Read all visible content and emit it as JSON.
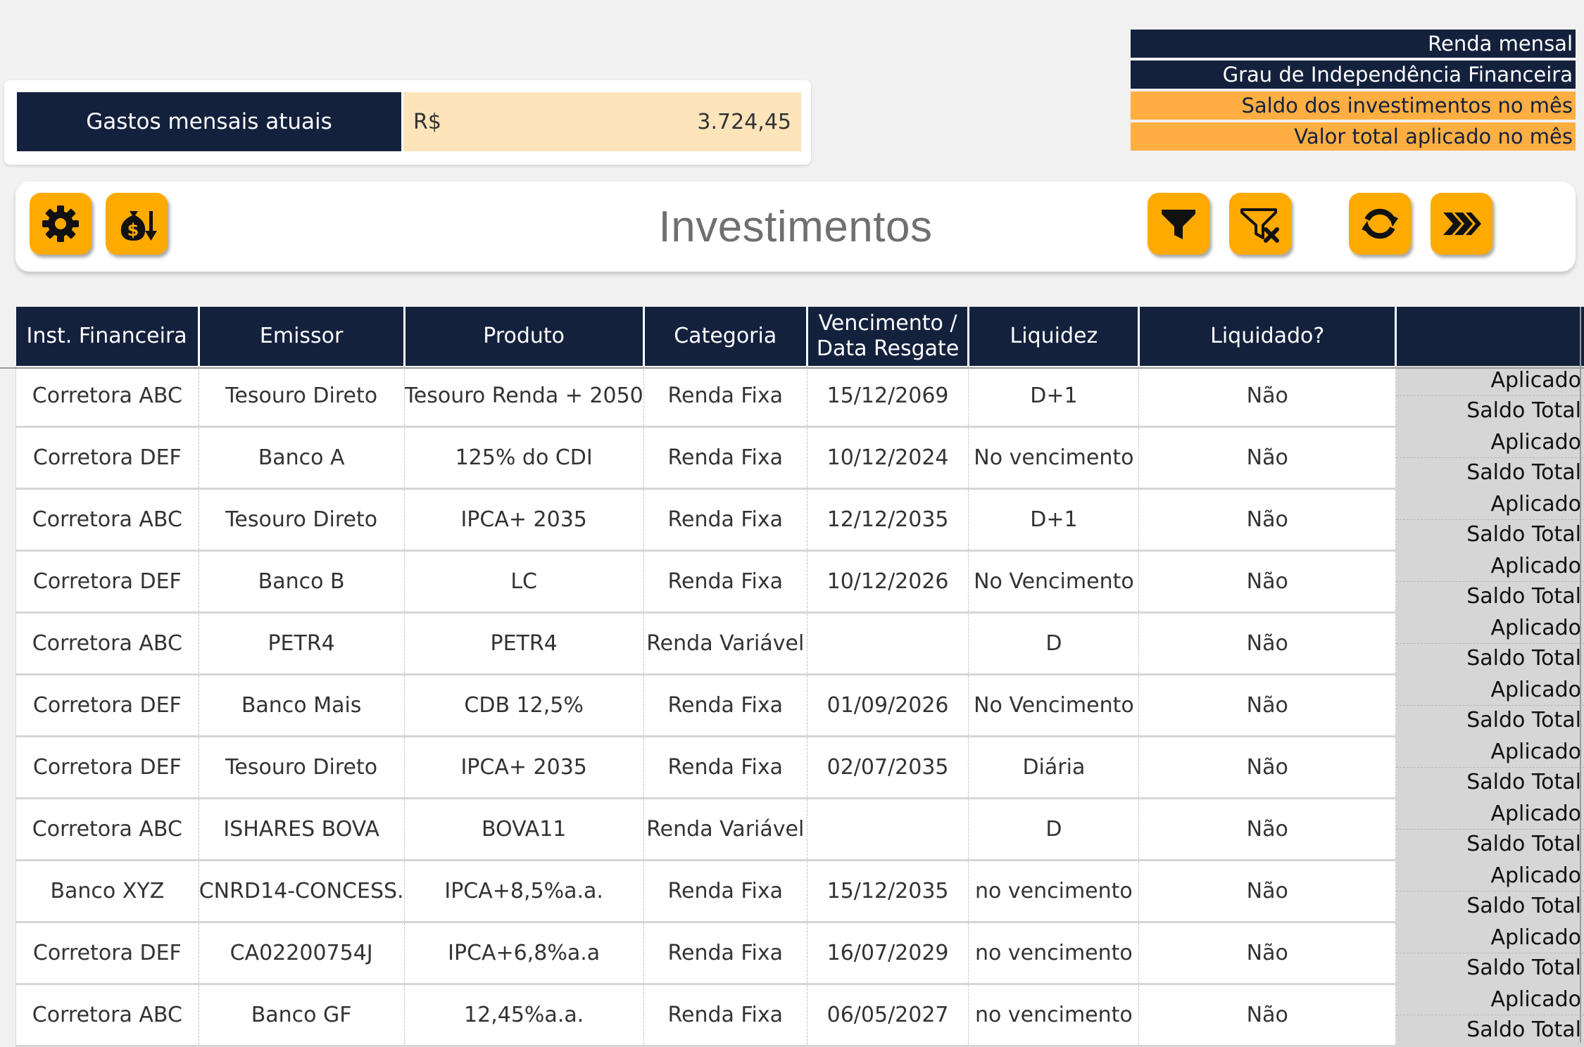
{
  "gastos": {
    "label": "Gastos mensais atuais",
    "currency": "R$",
    "value": "3.724,45"
  },
  "summary": [
    {
      "label": "Renda mensal",
      "style": "dark"
    },
    {
      "label": "Grau de Independência Financeira",
      "style": "dark"
    },
    {
      "label": "Saldo dos investimentos no mês",
      "style": "orange"
    },
    {
      "label": "Valor total aplicado no mês",
      "style": "orange"
    }
  ],
  "toolbar": {
    "title": "Investimentos",
    "buttons": [
      {
        "icon": "gear-icon"
      },
      {
        "icon": "money-bag-down-icon"
      },
      {
        "icon": "filter-icon"
      },
      {
        "icon": "clear-filter-icon"
      },
      {
        "icon": "refresh-icon"
      },
      {
        "icon": "fast-forward-icon"
      }
    ]
  },
  "colors": {
    "navy": "#14213d",
    "orange": "#ffaa00",
    "light_orange": "#fde4bb",
    "side_gray": "#d6d6d6"
  },
  "table": {
    "headers": [
      "Inst. Financeira",
      "Emissor",
      "Produto",
      "Categoria",
      "Vencimento / Data Resgate",
      "Liquidez",
      "Liquidado?",
      ""
    ],
    "side_labels": {
      "top": "Aplicado",
      "bottom": "Saldo Total"
    },
    "rows": [
      [
        "Corretora ABC",
        "Tesouro Direto",
        "Tesouro Renda + 2050",
        "Renda Fixa",
        "15/12/2069",
        "D+1",
        "Não"
      ],
      [
        "Corretora DEF",
        "Banco A",
        "125% do CDI",
        "Renda Fixa",
        "10/12/2024",
        "No vencimento",
        "Não"
      ],
      [
        "Corretora ABC",
        "Tesouro Direto",
        "IPCA+ 2035",
        "Renda Fixa",
        "12/12/2035",
        "D+1",
        "Não"
      ],
      [
        "Corretora DEF",
        "Banco B",
        "LC",
        "Renda Fixa",
        "10/12/2026",
        "No Vencimento",
        "Não"
      ],
      [
        "Corretora ABC",
        "PETR4",
        "PETR4",
        "Renda Variável",
        "",
        "D",
        "Não"
      ],
      [
        "Corretora DEF",
        "Banco Mais",
        "CDB 12,5%",
        "Renda Fixa",
        "01/09/2026",
        "No Vencimento",
        "Não"
      ],
      [
        "Corretora DEF",
        "Tesouro Direto",
        "IPCA+ 2035",
        "Renda Fixa",
        "02/07/2035",
        "Diária",
        "Não"
      ],
      [
        "Corretora ABC",
        "ISHARES BOVA",
        "BOVA11",
        "Renda Variável",
        "",
        "D",
        "Não"
      ],
      [
        "Banco XYZ",
        "CNRD14-CONCESS.",
        "IPCA+8,5%a.a.",
        "Renda Fixa",
        "15/12/2035",
        "no vencimento",
        "Não"
      ],
      [
        "Corretora DEF",
        "CA02200754J",
        "IPCA+6,8%a.a",
        "Renda Fixa",
        "16/07/2029",
        "no vencimento",
        "Não"
      ],
      [
        "Corretora ABC",
        "Banco GF",
        "12,45%a.a.",
        "Renda Fixa",
        "06/05/2027",
        "no vencimento",
        "Não"
      ]
    ]
  }
}
